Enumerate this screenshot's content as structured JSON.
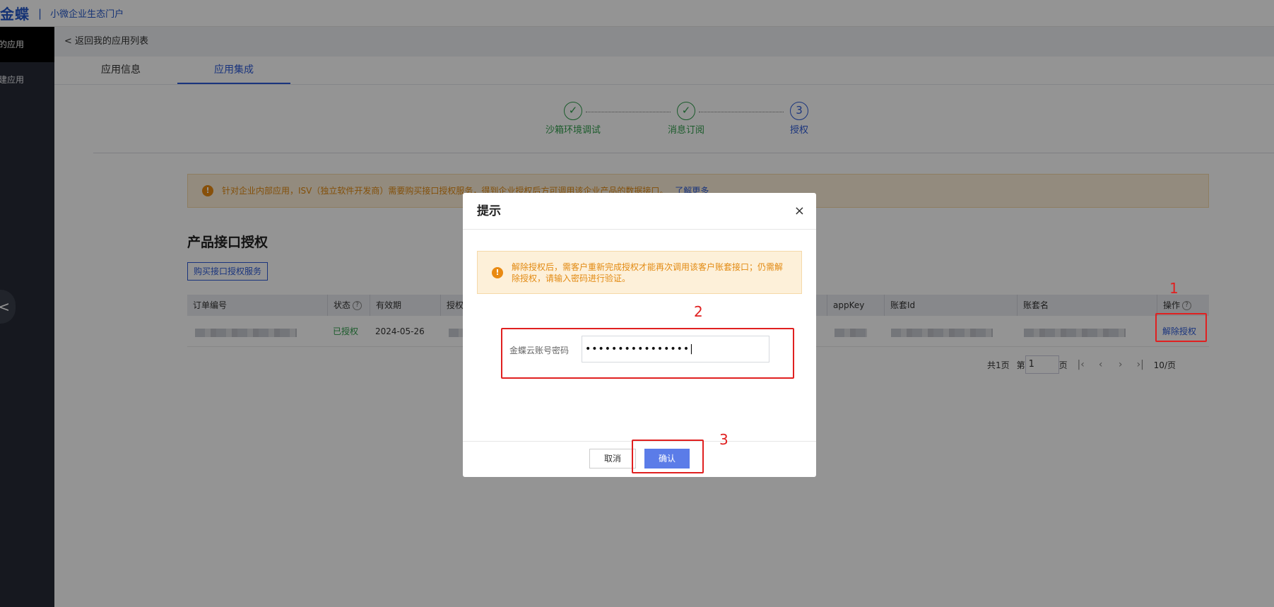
{
  "topbar": {
    "logo": "金蝶",
    "separator": "|",
    "portal": "小微企业生态门户"
  },
  "sidebar": {
    "items": [
      {
        "label": "我的应用"
      },
      {
        "label": "创建应用"
      }
    ],
    "handle": "<"
  },
  "main": {
    "back_link": "< 返回我的应用列表",
    "tabs": [
      {
        "label": "应用信息"
      },
      {
        "label": "应用集成"
      }
    ],
    "steps": [
      {
        "label": "沙箱环境调试",
        "status": "done",
        "icon": "check-icon"
      },
      {
        "label": "消息订阅",
        "status": "done",
        "icon": "check-icon"
      },
      {
        "label": "授权",
        "status": "current",
        "number": "3"
      }
    ],
    "notice": {
      "text": "针对企业内部应用，ISV（独立软件开发商）需要购买接口授权服务，得到企业授权后方可调用该企业产品的数据接口。",
      "link": "了解更多"
    },
    "section_title": "产品接口授权",
    "buy_button": "购买接口授权服务",
    "table": {
      "headers": [
        "订单编号",
        "状态",
        "有效期",
        "授权",
        "appKey",
        "账套Id",
        "账套名",
        "操作"
      ],
      "row": {
        "status": "已授权",
        "expiry": "2024-05-26",
        "action": "解除授权"
      }
    },
    "pager": {
      "total": "共1页",
      "prefix": "第",
      "page": "1",
      "suffix": "页",
      "page_size": "10/页"
    }
  },
  "modal": {
    "title": "提示",
    "close": "×",
    "alert": "解除授权后，需客户重新完成授权才能再次调用该客户账套接口；仍需解除授权，请输入密码进行验证。",
    "password_label": "金蝶云账号密码",
    "password_value": "••••••••••••••••|",
    "cancel": "取消",
    "confirm": "确认"
  },
  "annotations": [
    {
      "label": "1"
    },
    {
      "label": "2"
    },
    {
      "label": "3"
    }
  ],
  "colors": {
    "accent": "#2d5bd8",
    "success": "#2f9e4b",
    "warning": "#e28a12",
    "annotation": "#e02020"
  }
}
